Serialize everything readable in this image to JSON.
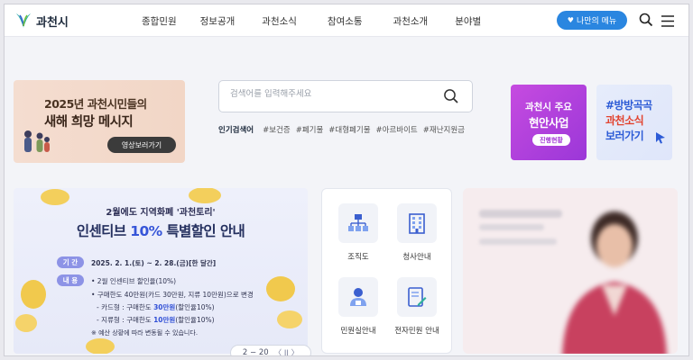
{
  "header": {
    "logo_text": "과천시",
    "nav": [
      "종합민원",
      "정보공개",
      "과천소식",
      "참여소통",
      "과천소개",
      "분야별"
    ],
    "my_menu_label": "나만의 메뉴"
  },
  "promo": {
    "line1": "2025년 과천시민들의",
    "line2": "새해 희망 메시지",
    "button_label": "영상보러가기"
  },
  "search": {
    "placeholder": "검색어를 입력해주세요",
    "popular_label": "인기검색어",
    "popular_terms": [
      "#보건증",
      "#폐기물",
      "#대형폐기물",
      "#아르바이트",
      "#재난지원금"
    ]
  },
  "banner_a": {
    "line1": "과천시 주요",
    "line2": "현안사업",
    "button_label": "진행현황"
  },
  "banner_b": {
    "line1": "#방방곡곡",
    "line2": "과천소식",
    "line3": "보러가기"
  },
  "voucher": {
    "subtitle": "2월에도 지역화폐 '과천토리'",
    "title_pre": "인센티브 ",
    "title_highlight": "10%",
    "title_post": " 특별할인 안내",
    "period_tag": "기 간",
    "period_text": "2025. 2. 1.(토) ~ 2. 28.(금)[한 달간]",
    "content_tag": "내 용",
    "content_line1": "• 2월 인센티브 할인율(10%)",
    "content_line2": "• 구매한도 40만원(카드 30만원, 지류 10만원)으로 변경",
    "card_pre": "- 카드형 : 구매한도 ",
    "card_value": "30만원",
    "card_post": "(할인율10%)",
    "paper_pre": "- 지류형 : 구매한도 ",
    "paper_value": "10만원",
    "paper_post": "(할인율10%)",
    "note": "※ 예산 상황에 따라 변동될 수 있습니다."
  },
  "pager": {
    "text": "2 − 20",
    "controls": "〈 II 〉"
  },
  "quick_services": [
    {
      "label": "조직도",
      "icon": "org-chart-icon"
    },
    {
      "label": "청사안내",
      "icon": "building-icon"
    },
    {
      "label": "민원실안내",
      "icon": "person-icon"
    },
    {
      "label": "전자민원 안내",
      "icon": "e-document-icon"
    }
  ],
  "colors": {
    "accent_blue": "#2a86e0",
    "voucher_blue": "#3655d8",
    "banner_purple": "#b040dc"
  }
}
